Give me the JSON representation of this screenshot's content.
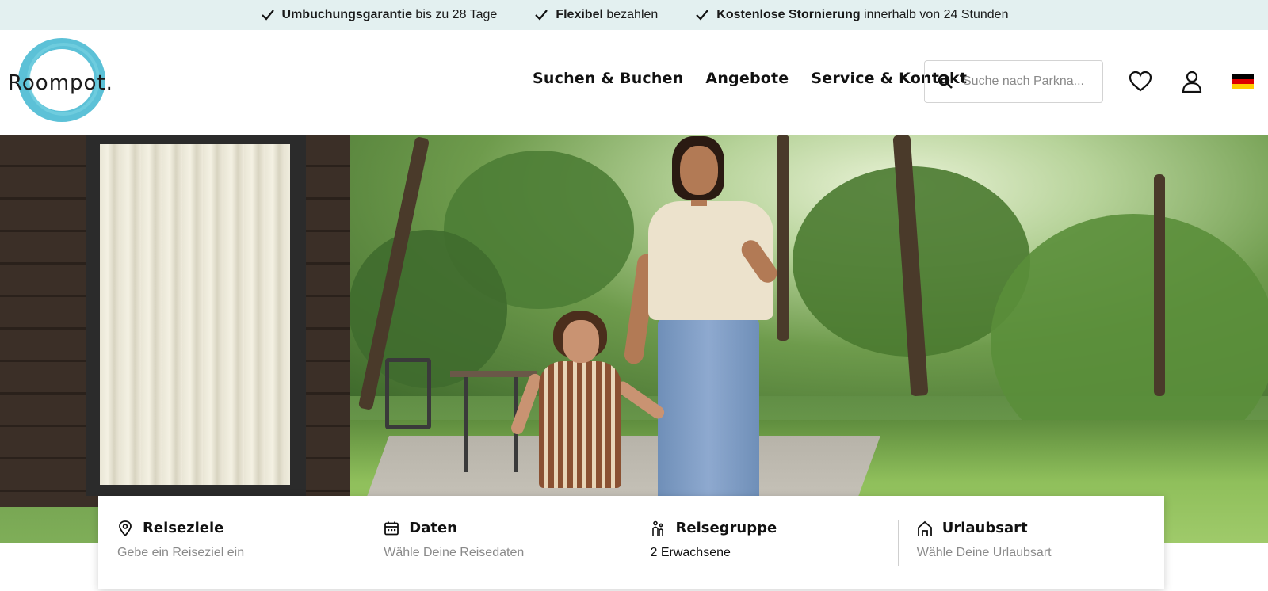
{
  "usp": [
    {
      "bold": "Umbuchungsgarantie",
      "rest": " bis zu 28 Tage"
    },
    {
      "bold": "Flexibel",
      "rest": " bezahlen"
    },
    {
      "bold": "Kostenlose Stornierung",
      "rest": " innerhalb von 24 Stunden"
    }
  ],
  "logo": {
    "text": "Roompot."
  },
  "nav": {
    "search_book": "Suchen & Buchen",
    "offers": "Angebote",
    "service": "Service & Kontakt"
  },
  "search": {
    "placeholder": "Suche nach Parkna..."
  },
  "icons": {
    "check": "check-icon",
    "search": "search-icon",
    "favorites": "heart-icon",
    "account": "user-icon",
    "language": "flag-de-icon"
  },
  "colors": {
    "usp_bg": "#e3f0f0",
    "logo_ring": "#3fb6d0"
  },
  "booking": {
    "destination": {
      "title": "Reiseziele",
      "value": "Gebe ein Reiseziel ein"
    },
    "dates": {
      "title": "Daten",
      "value": "Wähle Deine Reisedaten"
    },
    "group": {
      "title": "Reisegruppe",
      "value": "2 Erwachsene"
    },
    "type": {
      "title": "Urlaubsart",
      "value": "Wähle Deine Urlaubsart"
    }
  }
}
